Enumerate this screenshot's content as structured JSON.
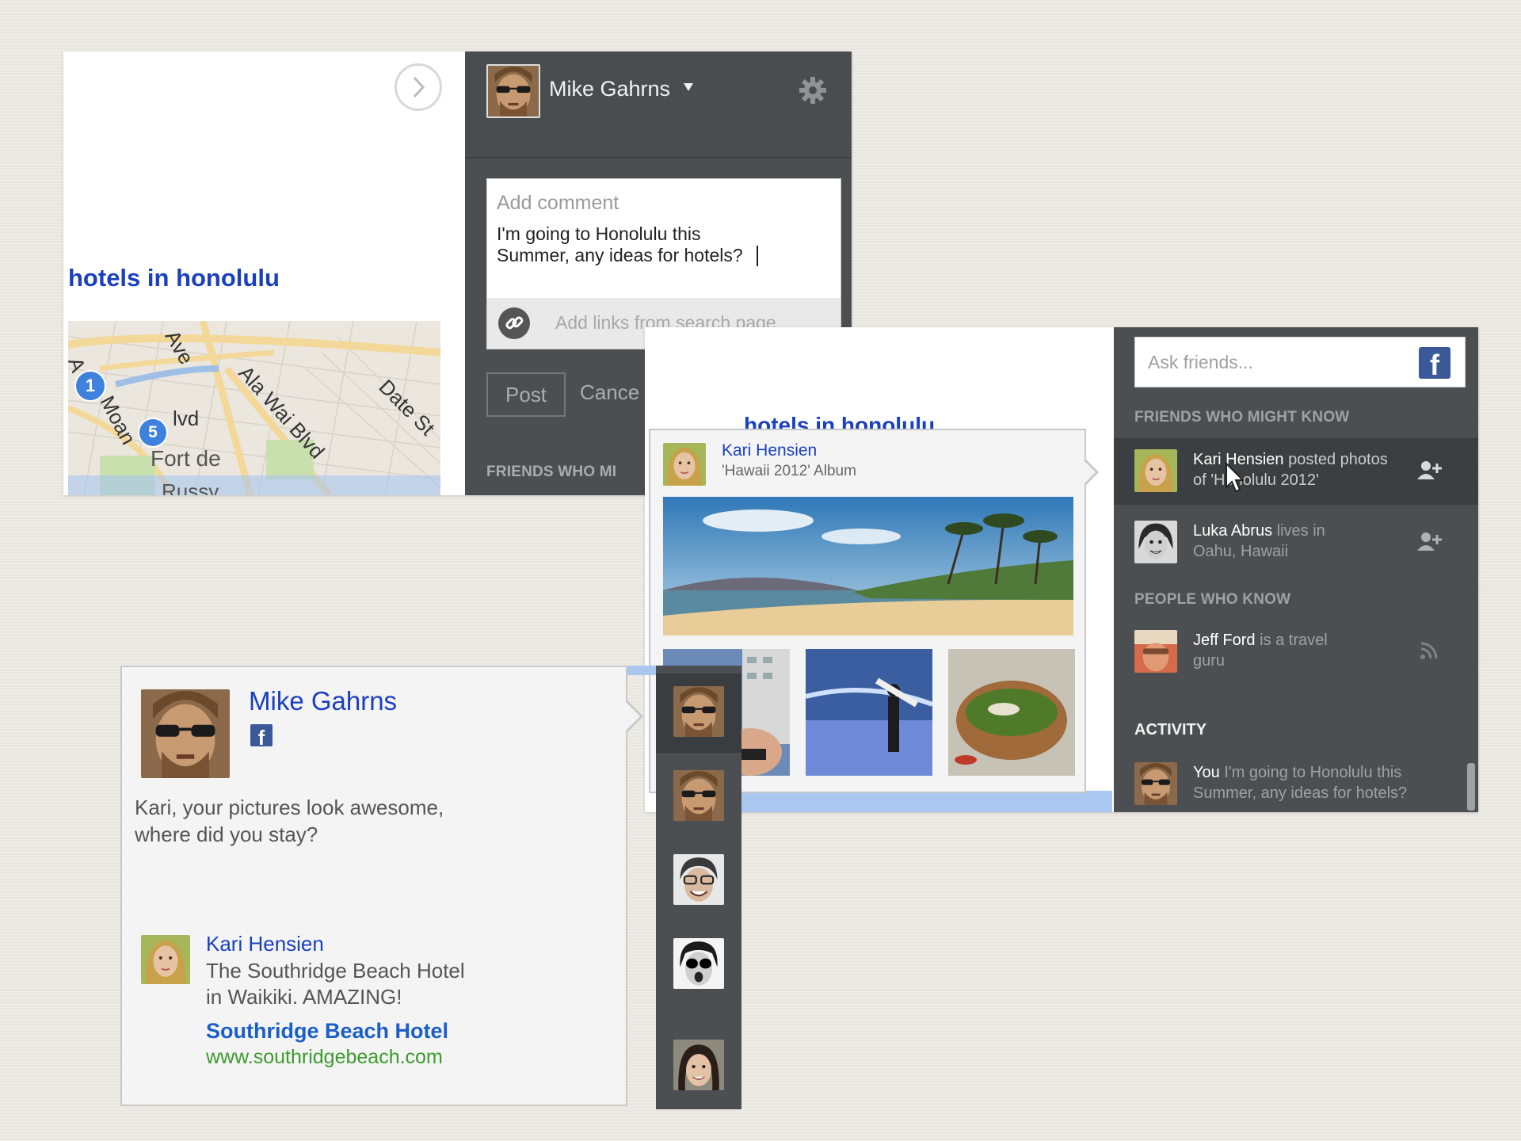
{
  "top_panel": {
    "search_heading": "hotels in honolulu",
    "map_labels": [
      "Ave",
      "Ala Wai Blvd",
      "Date St",
      "Fort de",
      "Russy",
      "lvd",
      "Moan",
      "A"
    ],
    "map_pins": [
      "1",
      "5"
    ],
    "user_name": "Mike Gahrns",
    "comment_placeholder": "Add comment",
    "comment_text_line1": "I'm going to Honolulu this",
    "comment_text_line2": "Summer, any ideas for hotels?",
    "add_links_label": "Add links from search page",
    "post_label": "Post",
    "cancel_label": "Cance",
    "friends_heading": "FRIENDS WHO MI"
  },
  "right_panel": {
    "search_heading": "hotels in honolulu",
    "ask_placeholder": "Ask friends...",
    "friends_heading": "FRIENDS WHO MIGHT KNOW",
    "friends": [
      {
        "name": "Kari Hensien",
        "line1_rest": "posted photos",
        "line2": "of 'Honolulu 2012'"
      },
      {
        "name": "Luka Abrus",
        "line1_rest": "lives in",
        "line2": "Oahu, Hawaii"
      }
    ],
    "people_heading": "PEOPLE WHO KNOW",
    "people": [
      {
        "name": "Jeff Ford",
        "line1_rest": "is a travel",
        "line2": "guru"
      }
    ],
    "activity_heading": "ACTIVITY",
    "activity": [
      {
        "name": "You",
        "line1_rest": "I'm going to Honolulu this",
        "line2": "Summer, any ideas for hotels?"
      }
    ],
    "popup": {
      "name": "Kari Hensien",
      "album": "'Hawaii 2012' Album"
    }
  },
  "bottom_panel": {
    "name": "Mike Gahrns",
    "comment_line1": "Kari, your pictures look awesome,",
    "comment_line2": "where did you stay?",
    "reply_name": "Kari Hensien",
    "reply_line1": "The Southridge Beach Hotel",
    "reply_line2": "in Waikiki. AMAZING!",
    "result_title": "Southridge Beach Hotel",
    "result_url": "www.southridgebeach.com"
  },
  "colors": {
    "link_blue": "#1a3fbf",
    "url_green": "#3b9b2c",
    "sidebar_dark": "#4c4f51",
    "facebook_blue": "#3b5998"
  }
}
